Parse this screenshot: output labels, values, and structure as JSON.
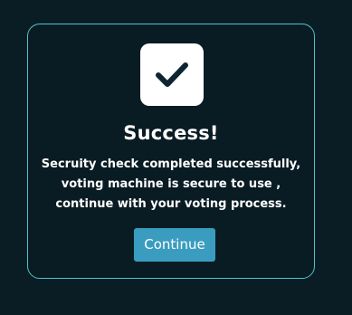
{
  "dialog": {
    "icon": "check-icon",
    "title": "Success!",
    "message_lines": [
      "Secruity check completed successfully,",
      "voting machine is secure to use ,",
      "continue with your voting process."
    ],
    "continue_label": "Continue"
  },
  "colors": {
    "background": "#0b1d24",
    "card_border": "#4fc3c8",
    "button": "#3a9dc0",
    "text": "#ffffff",
    "icon_check": "#0d2530"
  }
}
